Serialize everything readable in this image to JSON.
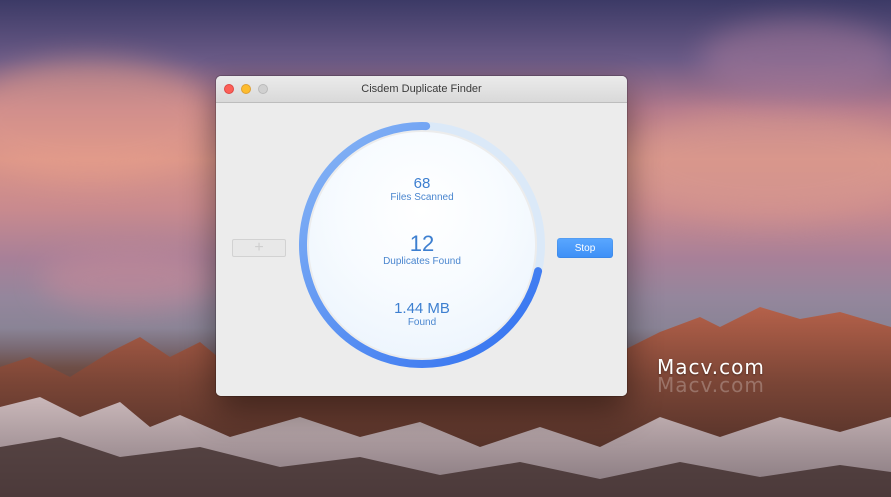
{
  "window": {
    "title": "Cisdem Duplicate Finder"
  },
  "scan": {
    "files_scanned_value": "68",
    "files_scanned_label": "Files Scanned",
    "duplicates_value": "12",
    "duplicates_label": "Duplicates Found",
    "size_value": "1.44 MB",
    "size_label": "Found",
    "progress_fraction": 0.72
  },
  "buttons": {
    "add_label": "+",
    "stop_label": "Stop"
  },
  "watermark": {
    "text": "Macv.com"
  },
  "colors": {
    "accent": "#3d8ff6",
    "ring_blue": "#4a8ef0",
    "ring_light": "#dbe9f8"
  },
  "icons": {
    "add": "plus-icon"
  }
}
